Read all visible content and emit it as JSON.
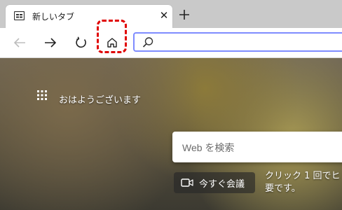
{
  "tab": {
    "title": "新しいタブ",
    "favicon": "newtab-icon",
    "close_icon": "close-icon"
  },
  "toolbar": {
    "new_tab_icon": "plus-icon",
    "back_icon": "back-arrow-icon",
    "forward_icon": "forward-arrow-icon",
    "refresh_icon": "refresh-icon",
    "home_icon": "home-icon",
    "address": {
      "value": "",
      "placeholder": "",
      "icon": "search-icon"
    },
    "highlight_color": "#e00000",
    "address_border_color": "#7f8cff"
  },
  "ntp": {
    "apps_icon": "app-launcher-icon",
    "greeting": "おはようございます",
    "search": {
      "placeholder": "Web を検索"
    },
    "meet_now": {
      "label": "今すぐ会議",
      "icon": "video-camera-icon"
    },
    "promo_text": "クリック 1 回でヒ要です。"
  }
}
